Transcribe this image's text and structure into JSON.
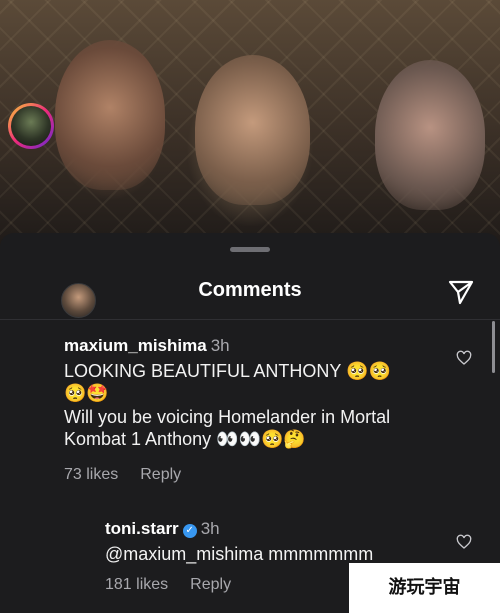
{
  "header": {
    "title": "Comments"
  },
  "comments": [
    {
      "username": "maxium_mishima",
      "time": "3h",
      "lines": [
        "LOOKING BEAUTIFUL ANTHONY 🥺🥺",
        "🥺🤩",
        "Will you be voicing Homelander in Mortal",
        "Kombat 1 Anthony 👀👀🥺🤔"
      ],
      "line_text": {
        "l1": "LOOKING BEAUTIFUL ANTHONY",
        "l3": "Will you be voicing Homelander in Mortal",
        "l4": "Kombat 1 Anthony"
      },
      "emoji": {
        "pleading": "🥺",
        "star_struck": "🤩",
        "eyes": "👀",
        "thinking": "🤔"
      },
      "likes": "73 likes",
      "reply": "Reply"
    },
    {
      "username": "toni.starr",
      "verified": true,
      "verified_glyph": "✓",
      "time": "3h",
      "text": "@maxium_mishima mmmmmmm",
      "likes": "181 likes",
      "reply": "Reply"
    }
  ],
  "watermark": "游玩宇宙",
  "colors": {
    "sheet_bg": "#1c1c1e",
    "text_primary": "#ffffff",
    "text_secondary": "#a8a8ad",
    "verified_blue": "#3897f0"
  },
  "icons": [
    "share-send-icon",
    "heart-icon"
  ]
}
